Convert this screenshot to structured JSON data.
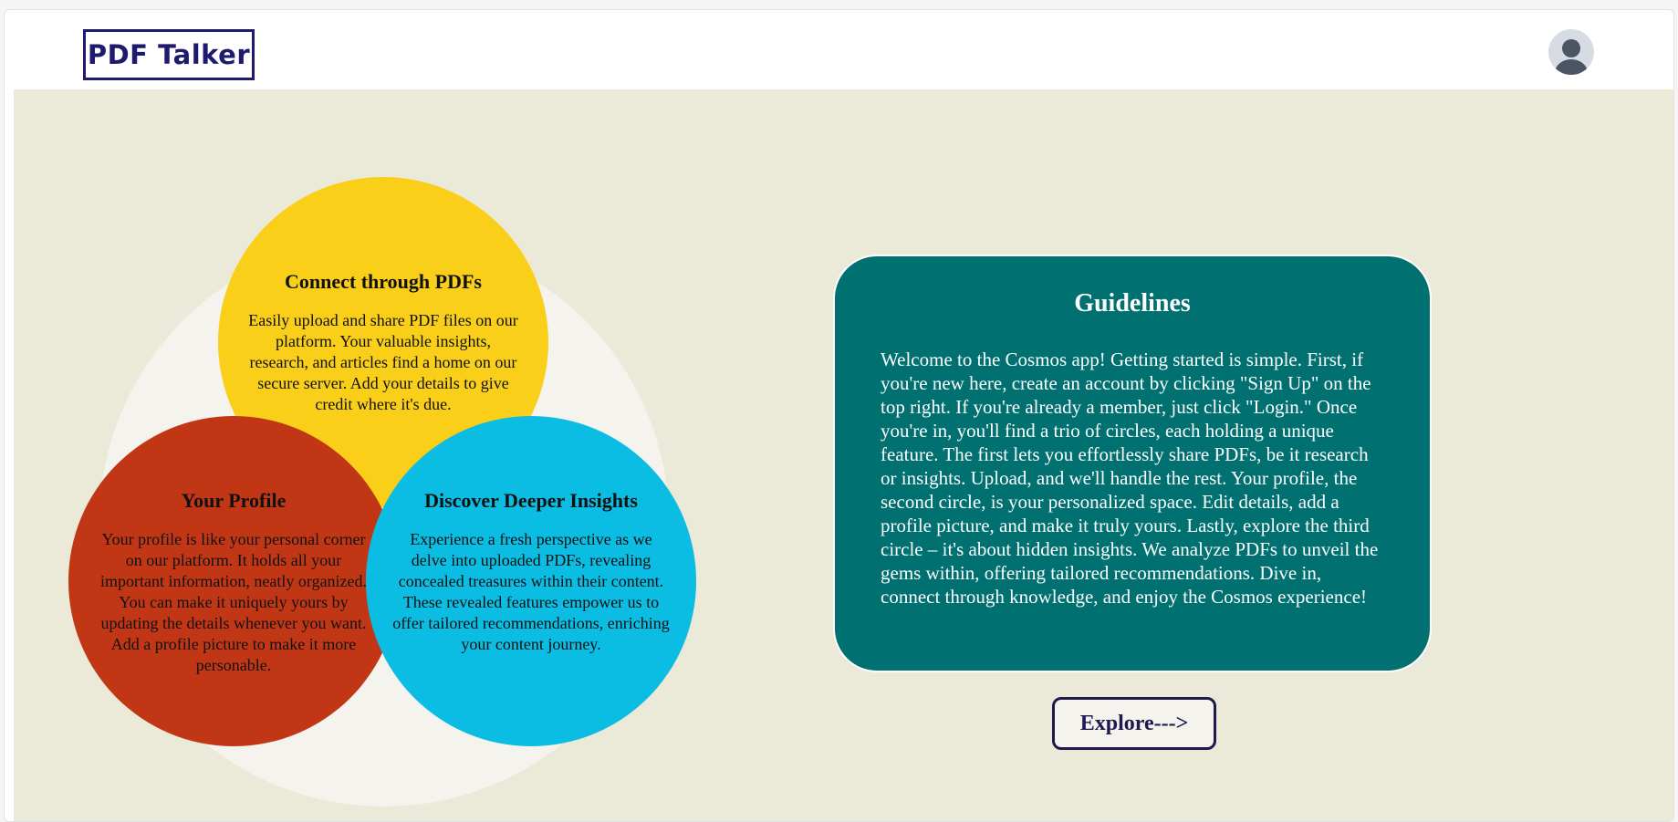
{
  "header": {
    "logo_text": "PDF Talker",
    "avatar_icon": "user-avatar-icon"
  },
  "features": [
    {
      "title": "Connect through PDFs",
      "text": "Easily upload and share PDF files on our platform. Your valuable insights, research, and articles find a home on our secure server. Add your details to give credit where it's due.",
      "color": "#f9cf1a"
    },
    {
      "title": "Your Profile",
      "text": "Your profile is like your personal corner on our platform. It holds all your important information, neatly organized. You can make it uniquely yours by updating the details whenever you want. Add a profile picture to make it more personable.",
      "color": "#c13716"
    },
    {
      "title": "Discover Deeper Insights",
      "text": "Experience a fresh perspective as we delve into uploaded PDFs, revealing concealed treasures within their content. These revealed features empower us to offer tailored recommendations, enriching your content journey.",
      "color": "#0bbde3"
    }
  ],
  "guidelines": {
    "title": "Guidelines",
    "text": "Welcome to the Cosmos app! Getting started is simple. First, if you're new here, create an account by clicking \"Sign Up\" on the top right. If you're already a member, just click \"Login.\" Once you're in, you'll find a trio of circles, each holding a unique feature. The first lets you effortlessly share PDFs, be it research or insights. Upload, and we'll handle the rest. Your profile, the second circle, is your personalized space. Edit details, add a profile picture, and make it truly yours. Lastly, explore the third circle – it's about hidden insights. We analyze PDFs to unveil the gems within, offering tailored recommendations. Dive in, connect through knowledge, and enjoy the Cosmos experience!",
    "color": "#007070"
  },
  "explore_button": {
    "label": "Explore--->"
  },
  "colors": {
    "brand": "#1e1a6e",
    "background": "#ebe9d8"
  }
}
